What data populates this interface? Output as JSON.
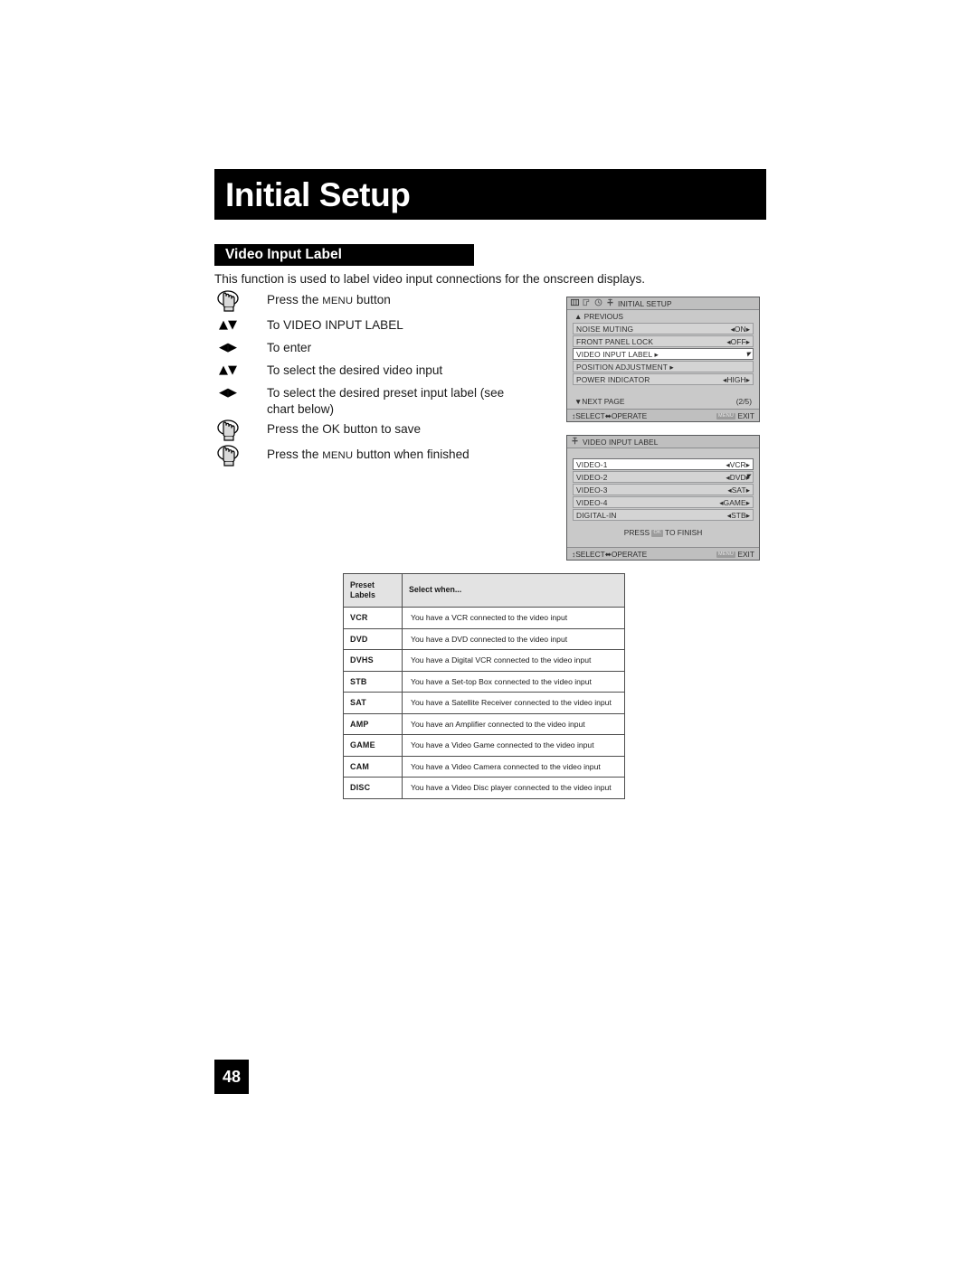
{
  "page": {
    "chapter_title": "Initial Setup",
    "section_title": "Video Input Label",
    "intro": "This function is used to label video input connections for the onscreen displays.",
    "page_number": "48"
  },
  "steps": [
    {
      "icon": "hand-press-icon",
      "pre": "Press the ",
      "caps": "MENU",
      "post": " button"
    },
    {
      "icon": "up-down-arrow-icon",
      "glyph": "▲▼",
      "text": "To VIDEO INPUT LABEL"
    },
    {
      "icon": "left-right-arrow-icon",
      "glyph": "◀▶",
      "text": "To enter"
    },
    {
      "icon": "up-down-arrow-icon",
      "glyph": "▲▼",
      "text": "To select the desired video input"
    },
    {
      "icon": "left-right-arrow-icon",
      "glyph": "◀▶",
      "text": "To select the desired preset input label (see chart below)"
    },
    {
      "icon": "hand-press-icon",
      "text": "Press the OK button to save"
    },
    {
      "icon": "hand-press-icon",
      "pre": "Press the ",
      "caps": "MENU",
      "post": " button when finished"
    }
  ],
  "osd_initial_setup": {
    "title": "INITIAL SETUP",
    "title_icons": [
      "book-icon",
      "picture-icon",
      "clock-icon",
      "lock-icon"
    ],
    "previous_label": "PREVIOUS",
    "previous_arrow": "▲",
    "rows": [
      {
        "label": "NOISE MUTING",
        "value": "ON",
        "selected": false,
        "has_value": true
      },
      {
        "label": "FRONT PANEL LOCK",
        "value": "OFF",
        "selected": false,
        "has_value": true
      },
      {
        "label": "VIDEO INPUT LABEL ▸",
        "value": "",
        "selected": true,
        "has_value": false
      },
      {
        "label": "POSITION ADJUSTMENT ▸",
        "value": "",
        "selected": false,
        "has_value": false
      },
      {
        "label": "POWER INDICATOR",
        "value": "HIGH",
        "selected": false,
        "has_value": true
      }
    ],
    "next_page_label": "NEXT PAGE",
    "next_page_arrow": "▼",
    "page_counter": "(2/5)",
    "footer_select": "SELECT",
    "footer_operate": "OPERATE",
    "footer_exit": "EXIT",
    "footer_exit_chip": "MENU"
  },
  "osd_video_input_label": {
    "title": "VIDEO INPUT LABEL",
    "title_icons": [
      "lock-icon"
    ],
    "rows": [
      {
        "label": "VIDEO-1",
        "value": "VCR",
        "selected": true
      },
      {
        "label": "VIDEO-2",
        "value": "DVD",
        "selected": false
      },
      {
        "label": "VIDEO-3",
        "value": "SAT",
        "selected": false
      },
      {
        "label": "VIDEO-4",
        "value": "GAME",
        "selected": false
      },
      {
        "label": "DIGITAL-IN",
        "value": "STB",
        "selected": false
      }
    ],
    "finish_pre": "PRESS ",
    "finish_chip": "OK",
    "finish_post": " TO FINISH",
    "footer_select": "SELECT",
    "footer_operate": "OPERATE",
    "footer_exit": "EXIT",
    "footer_exit_chip": "MENU"
  },
  "preset_table": {
    "header_label": "Preset\nLabels",
    "header_label_line1": "Preset",
    "header_label_line2": "Labels",
    "header_desc": "Select when...",
    "rows": [
      {
        "label": "VCR",
        "desc": "You have a VCR connected to the video input"
      },
      {
        "label": "DVD",
        "desc": "You have a DVD connected to the video input"
      },
      {
        "label": "DVHS",
        "desc": "You have a Digital VCR connected to the video input"
      },
      {
        "label": "STB",
        "desc": "You have a Set-top Box connected to the video input"
      },
      {
        "label": "SAT",
        "desc": "You have a Satellite Receiver connected to the video input"
      },
      {
        "label": "AMP",
        "desc": "You have an Amplifier connected to the video input"
      },
      {
        "label": "GAME",
        "desc": "You have a Video Game connected to the video input"
      },
      {
        "label": "CAM",
        "desc": "You have a Video Camera connected to the video input"
      },
      {
        "label": "DISC",
        "desc": "You have a Video Disc player connected to the video input"
      }
    ]
  },
  "colors": {
    "title_bar": "#000000",
    "osd_background": "#c9c9c9",
    "osd_row": "#d4d4d4",
    "osd_row_selected": "#ffffff",
    "table_header": "#e3e3e3"
  }
}
